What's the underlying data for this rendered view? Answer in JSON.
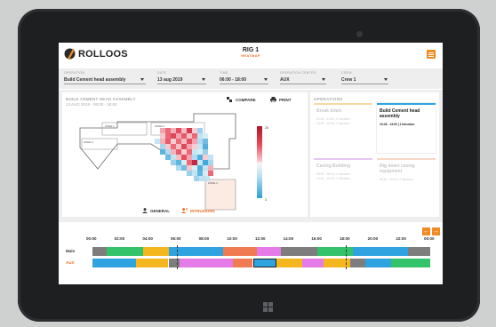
{
  "header": {
    "brand": "ROLLOOS",
    "rig_title": "RIG 1",
    "rig_subtitle": "HEATMAP"
  },
  "filters": [
    {
      "label": "OPERATION",
      "value": "Build Cement head assembly"
    },
    {
      "label": "DATE",
      "value": "13 aug 2019"
    },
    {
      "label": "TIME",
      "value": "06:00 - 18:00"
    },
    {
      "label": "OPERATION CENTER",
      "value": "AUX"
    },
    {
      "label": "CREW",
      "value": "Crew 1"
    }
  ],
  "heatmap": {
    "title": "BUILD CEMENT HEAD ASSEMBLY",
    "subtitle": "13 AUG 2019 - 06:00 - 18:00",
    "compare_label": "COMPARE",
    "print_label": "PRINT",
    "scale_max": "20",
    "scale_min": "3",
    "zones": [
      "ZONE 1",
      "ZONE 2",
      "ZONE 3",
      "ZONE 4"
    ],
    "tabs": {
      "general": "GENERAL",
      "intrusions": "INTRUSIONS"
    }
  },
  "operations": {
    "header": "OPERATIONS",
    "cards": [
      {
        "title": "Break down",
        "lines": [
          "02:00 - 04:00 | 0 Intrusion",
          "10:00 - 10:30 | 1 Intrusion"
        ],
        "bar": "#f5d9a6",
        "active": false
      },
      {
        "title": "Build Cement head assembly",
        "lines": [
          "10:45 - 13:00 | 1 Intrusion"
        ],
        "bar": "#2aa6df",
        "active": true
      },
      {
        "title": "Casing Building",
        "lines": [
          "08:00 - 08:20 | 2 Intrusion",
          "10:00 - 10:30 | 1 Intrusion"
        ],
        "bar": "#e7c7f0",
        "active": false
      },
      {
        "title": "Rig down casing equipment",
        "lines": [
          "08:15 - 10:00 | 0 Intrusion"
        ],
        "bar": "#f8d7c7",
        "active": false
      }
    ]
  },
  "timeline": {
    "hours": [
      "00:00",
      "02:00",
      "04:00",
      "06:00",
      "08:00",
      "10:00",
      "12:00",
      "14:00",
      "16:00",
      "18:00",
      "20:00",
      "22:00",
      "00:00"
    ],
    "rows": [
      "Main",
      "AUX"
    ],
    "prev_label": "←",
    "next_label": "→"
  }
}
